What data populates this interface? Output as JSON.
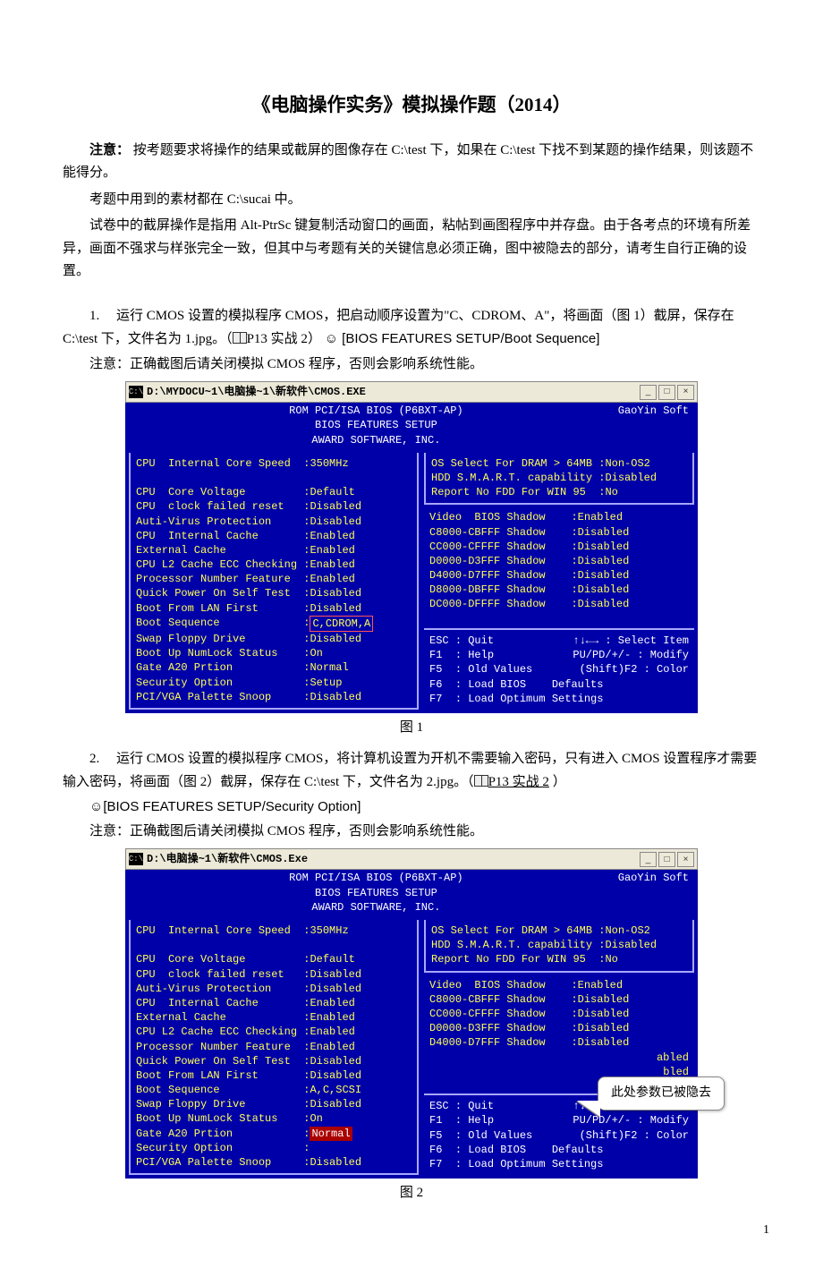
{
  "title": "《电脑操作实务》模拟操作题（2014）",
  "notice_label": "注意：",
  "notice_text": "按考题要求将操作的结果或截屏的图像存在 C:\\test 下，如果在 C:\\test 下找不到某题的操作结果，则该题不能得分。",
  "p2": "考题中用到的素材都在 C:\\sucai 中。",
  "p3": "试卷中的截屏操作是指用 Alt-PtrSc 键复制活动窗口的画面，粘帖到画图程序中并存盘。由于各考点的环境有所差异，画面不强求与样张完全一致，但其中与考题有关的关键信息必须正确，图中被隐去的部分，请考生自行正确的设置。",
  "q1": {
    "num": "1.",
    "text_a": "运行 CMOS 设置的模拟程序 CMOS，把启动顺序设置为\"C、CDROM、A\"，将画面（图 1）截屏，保存在 C:\\test 下，文件名为 1.jpg。（",
    "ref": "P13 实战 2",
    "text_b": "）    ",
    "hint": "☺ [BIOS FEATURES SETUP/Boot Sequence]",
    "note": "注意：正确截图后请关闭模拟 CMOS 程序，否则会影响系统性能。"
  },
  "q2": {
    "num": "2.",
    "text_a": "运行 CMOS 设置的模拟程序 CMOS，将计算机设置为开机不需要输入密码，只有进入 CMOS 设置程序才需要输入密码，将画面（图 2）截屏，保存在 C:\\test 下，文件名为 2.jpg。（",
    "ref": "P13 实战 2",
    "text_b": " ）",
    "hint": "☺[BIOS FEATURES SETUP/Security Option]",
    "note": "注意：正确截图后请关闭模拟 CMOS 程序，否则会影响系统性能。"
  },
  "fig1_caption": "图 1",
  "fig2_caption": "图 2",
  "callout": "此处参数已被隐去",
  "page_num": "1",
  "bios": {
    "brand": "GaoYin Soft",
    "header_lines": "ROM PCI/ISA BIOS (P6BXT-AP)\nBIOS FEATURES SETUP\nAWARD SOFTWARE, INC.",
    "footer": {
      "esc": "ESC : Quit",
      "arrows": "↑↓←→ : Select Item",
      "f1": "F1  : Help",
      "modify": "PU/PD/+/- : Modify",
      "f5": "F5  : Old Values",
      "color": "(Shift)F2 : Color",
      "f6": "F6  : Load BIOS    Defaults",
      "f7": "F7  : Load Optimum Settings"
    },
    "fig1": {
      "title": "D:\\MYDOCU~1\\电脑操~1\\新软件\\CMOS.EXE",
      "left": [
        {
          "l": "CPU  Internal Core Speed  ",
          "v": "350MHz"
        },
        {
          "blank": true
        },
        {
          "l": "CPU  Core Voltage         ",
          "v": "Default"
        },
        {
          "l": "CPU  clock failed reset   ",
          "v": "Disabled"
        },
        {
          "l": "Auti-Virus Protection     ",
          "v": "Disabled"
        },
        {
          "l": "CPU  Internal Cache       ",
          "v": "Enabled"
        },
        {
          "l": "External Cache            ",
          "v": "Enabled"
        },
        {
          "l": "CPU L2 Cache ECC Checking ",
          "v": "Enabled"
        },
        {
          "l": "Processor Number Feature  ",
          "v": "Enabled"
        },
        {
          "l": "Quick Power On Self Test  ",
          "v": "Disabled"
        },
        {
          "l": "Boot From LAN First       ",
          "v": "Disabled"
        },
        {
          "l": "Boot Sequence             ",
          "v": "C,CDROM,A",
          "boxed": true
        },
        {
          "l": "Swap Floppy Drive         ",
          "v": "Disabled"
        },
        {
          "l": "Boot Up NumLock Status    ",
          "v": "On"
        },
        {
          "l": "Gate A20 Prtion           ",
          "v": "Normal"
        },
        {
          "l": "Security Option           ",
          "v": "Setup"
        },
        {
          "l": "PCI/VGA Palette Snoop     ",
          "v": "Disabled"
        }
      ],
      "right_top": [
        {
          "l": "OS Select For DRAM > 64MB ",
          "v": "Non-OS2"
        },
        {
          "l": "HDD S.M.A.R.T. capability ",
          "v": "Disabled"
        },
        {
          "l": "Report No FDD For WIN 95  ",
          "v": "No"
        }
      ],
      "right_mid": [
        {
          "l": "Video  BIOS Shadow    ",
          "v": "Enabled"
        },
        {
          "l": "C8000-CBFFF Shadow    ",
          "v": "Disabled"
        },
        {
          "l": "CC000-CFFFF Shadow    ",
          "v": "Disabled"
        },
        {
          "l": "D0000-D3FFF Shadow    ",
          "v": "Disabled"
        },
        {
          "l": "D4000-D7FFF Shadow    ",
          "v": "Disabled"
        },
        {
          "l": "D8000-DBFFF Shadow    ",
          "v": "Disabled"
        },
        {
          "l": "DC000-DFFFF Shadow    ",
          "v": "Disabled"
        }
      ]
    },
    "fig2": {
      "title": "D:\\电脑操~1\\新软件\\CMOS.Exe",
      "left": [
        {
          "l": "CPU  Internal Core Speed  ",
          "v": "350MHz"
        },
        {
          "blank": true
        },
        {
          "l": "CPU  Core Voltage         ",
          "v": "Default"
        },
        {
          "l": "CPU  clock failed reset   ",
          "v": "Disabled"
        },
        {
          "l": "Auti-Virus Protection     ",
          "v": "Disabled"
        },
        {
          "l": "CPU  Internal Cache       ",
          "v": "Enabled"
        },
        {
          "l": "External Cache            ",
          "v": "Enabled"
        },
        {
          "l": "CPU L2 Cache ECC Checking ",
          "v": "Enabled"
        },
        {
          "l": "Processor Number Feature  ",
          "v": "Enabled"
        },
        {
          "l": "Quick Power On Self Test  ",
          "v": "Disabled"
        },
        {
          "l": "Boot From LAN First       ",
          "v": "Disabled"
        },
        {
          "l": "Boot Sequence             ",
          "v": "A,C,SCSI"
        },
        {
          "l": "Swap Floppy Drive         ",
          "v": "Disabled"
        },
        {
          "l": "Boot Up NumLock Status    ",
          "v": "On"
        },
        {
          "l": "Gate A20 Prtion           ",
          "v": "Normal",
          "hl": true
        },
        {
          "l": "Security Option           ",
          "v": ""
        },
        {
          "l": "PCI/VGA Palette Snoop     ",
          "v": "Disabled"
        }
      ],
      "right_top": [
        {
          "l": "OS Select For DRAM > 64MB ",
          "v": "Non-OS2"
        },
        {
          "l": "HDD S.M.A.R.T. capability ",
          "v": "Disabled"
        },
        {
          "l": "Report No FDD For WIN 95  ",
          "v": "No"
        }
      ],
      "right_mid": [
        {
          "l": "Video  BIOS Shadow    ",
          "v": "Enabled"
        },
        {
          "l": "C8000-CBFFF Shadow    ",
          "v": "Disabled"
        },
        {
          "l": "CC000-CFFFF Shadow    ",
          "v": "Disabled"
        },
        {
          "l": "D0000-D3FFF Shadow    ",
          "v": "Disabled"
        },
        {
          "l": "D4000-D7FFF Shadow    ",
          "v": "Disabled"
        },
        {
          "l": "                      ",
          "v": "abled",
          "trunc": true
        },
        {
          "l": "                      ",
          "v": "bled",
          "trunc": true
        }
      ]
    }
  }
}
